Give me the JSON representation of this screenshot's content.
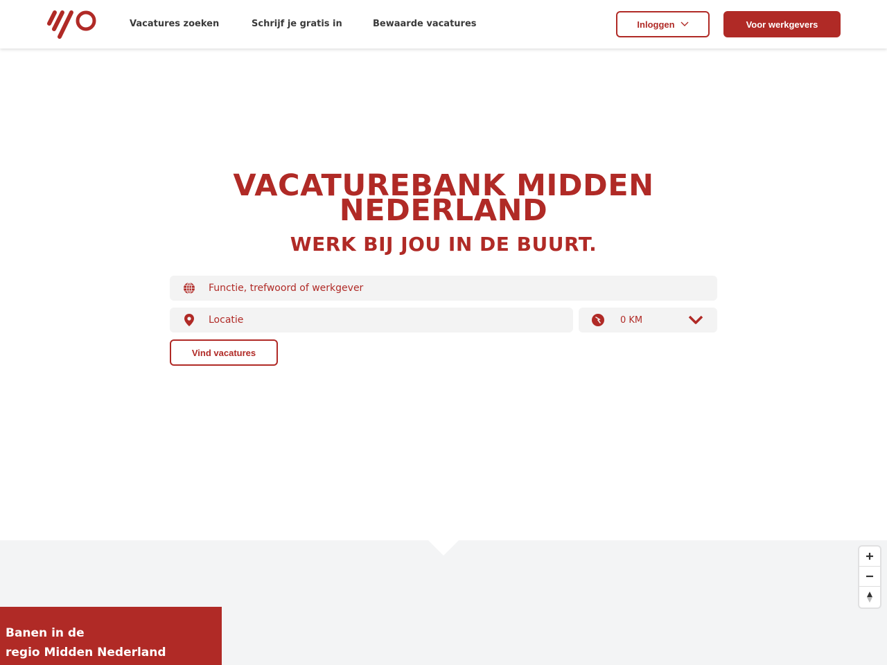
{
  "colors": {
    "brand": "#b02a26",
    "field_bg": "#f3f3f3",
    "map_bg": "#f3f4f5"
  },
  "header": {
    "nav": [
      {
        "label": "Vacatures zoeken"
      },
      {
        "label": "Schrijf je gratis in"
      },
      {
        "label": "Bewaarde vacatures"
      }
    ],
    "login_label": "Inloggen",
    "employers_label": "Voor werkgevers"
  },
  "hero": {
    "title_line1": "VACATUREBANK MIDDEN",
    "title_line2": "NEDERLAND",
    "subtitle": "WERK BIJ JOU IN DE BUURT."
  },
  "search": {
    "keyword_placeholder": "Functie, trefwoord of werkgever",
    "location_placeholder": "Locatie",
    "radius_value": "0 KM",
    "submit_label": "Vind vacatures"
  },
  "region": {
    "line1": "Banen in de",
    "line2": "regio Midden Nederland"
  },
  "icons": {
    "logo": "brand-logo",
    "keyword": "globe-icon",
    "location": "map-pin-icon",
    "radius": "radius-icon",
    "radius_toggle": "chevron-down-icon",
    "login_caret": "chevron-down-icon",
    "zoom_in": "plus-icon",
    "zoom_out": "minus-icon",
    "reset_north": "compass-icon"
  }
}
